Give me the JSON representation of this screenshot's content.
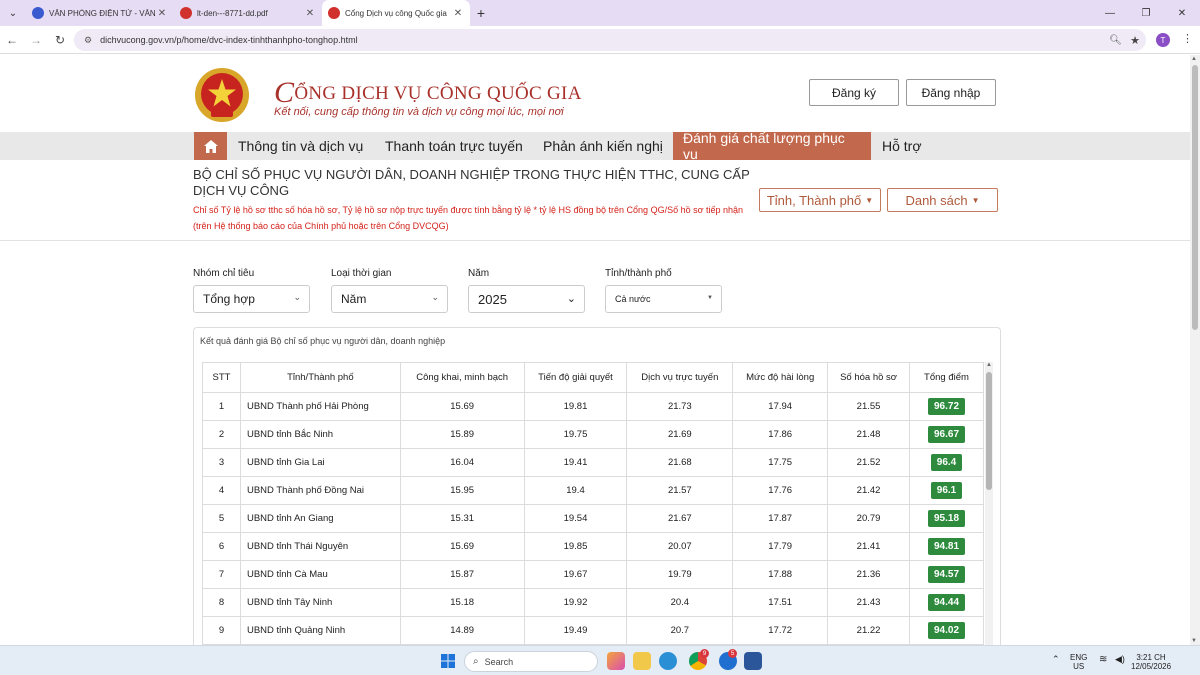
{
  "browser": {
    "tabs": [
      {
        "title": "VĂN PHÒNG ĐIỆN TỬ - VĂN PHÒNG",
        "favicon_color": "#3a5bd0",
        "active": false
      },
      {
        "title": "lt-den---8771-dd.pdf",
        "favicon_color": "#d0312d",
        "active": false
      },
      {
        "title": "Cổng Dịch vụ công Quốc gia",
        "favicon_color": "#d0312d",
        "active": true
      }
    ],
    "new_tab": "+",
    "url": "dichvucong.gov.vn/p/home/dvc-index-tinhthanhpho-tonghop.html",
    "profile_initial": "T"
  },
  "header": {
    "brand_title_initial": "C",
    "brand_title_rest": "ỔNG DỊCH VỤ CÔNG QUỐC GIA",
    "brand_subtitle": "Kết nối, cung cấp thông tin và dịch vụ công mọi lúc, mọi nơi",
    "register_label": "Đăng ký",
    "login_label": "Đăng nhập"
  },
  "nav": {
    "items": [
      {
        "label": "Thông tin và dịch vụ"
      },
      {
        "label": "Thanh toán trực tuyến"
      },
      {
        "label": "Phản ánh kiến nghị"
      },
      {
        "label": "Đánh giá chất lượng phục vụ"
      },
      {
        "label": "Hỗ trợ"
      }
    ]
  },
  "indicator": {
    "title": "BỘ CHỈ SỐ PHỤC VỤ NGƯỜI DÂN, DOANH NGHIỆP TRONG THỰC HIỆN TTHC, CUNG CẤP DỊCH VỤ CÔNG",
    "description": "Chỉ số Tỷ lệ hồ sơ tthc số hóa hồ sơ, Tỷ lệ hồ sơ nộp trực tuyến được tính bằng tỷ lệ * tỷ lệ HS đồng bộ trên Cổng QG/Số hồ sơ tiếp nhận (trên Hệ thống báo cáo của Chính phủ hoặc trên Cổng DVCQG)",
    "province_button": "Tỉnh, Thành phố",
    "list_button": "Danh sách"
  },
  "filters": [
    {
      "label": "Nhóm chỉ tiêu",
      "value": "Tổng hợp"
    },
    {
      "label": "Loại thời gian",
      "value": "Năm"
    },
    {
      "label": "Năm",
      "value": "2025"
    },
    {
      "label": "Tỉnh/thành phố",
      "value": "Cả nước"
    }
  ],
  "results": {
    "caption": "Kết quả đánh giá Bộ chỉ số phục vụ người dân, doanh nghiệp",
    "columns": [
      "STT",
      "Tỉnh/Thành phố",
      "Công khai, minh bạch",
      "Tiến độ giải quyết",
      "Dịch vụ trực tuyến",
      "Mức độ hài lòng",
      "Số hóa hồ sơ",
      "Tổng điểm"
    ],
    "rows": [
      [
        "1",
        "UBND Thành phố Hải Phòng",
        "15.69",
        "19.81",
        "21.73",
        "17.94",
        "21.55",
        "96.72"
      ],
      [
        "2",
        "UBND tỉnh Bắc Ninh",
        "15.89",
        "19.75",
        "21.69",
        "17.86",
        "21.48",
        "96.67"
      ],
      [
        "3",
        "UBND tỉnh Gia Lai",
        "16.04",
        "19.41",
        "21.68",
        "17.75",
        "21.52",
        "96.4"
      ],
      [
        "4",
        "UBND Thành phố Đồng Nai",
        "15.95",
        "19.4",
        "21.57",
        "17.76",
        "21.42",
        "96.1"
      ],
      [
        "5",
        "UBND tỉnh An Giang",
        "15.31",
        "19.54",
        "21.67",
        "17.87",
        "20.79",
        "95.18"
      ],
      [
        "6",
        "UBND tỉnh Thái Nguyên",
        "15.69",
        "19.85",
        "20.07",
        "17.79",
        "21.41",
        "94.81"
      ],
      [
        "7",
        "UBND tỉnh Cà Mau",
        "15.87",
        "19.67",
        "19.79",
        "17.88",
        "21.36",
        "94.57"
      ],
      [
        "8",
        "UBND tỉnh Tây Ninh",
        "15.18",
        "19.92",
        "20.4",
        "17.51",
        "21.43",
        "94.44"
      ],
      [
        "9",
        "UBND tỉnh Quảng Ninh",
        "14.89",
        "19.49",
        "20.7",
        "17.72",
        "21.22",
        "94.02"
      ]
    ]
  },
  "taskbar": {
    "search_placeholder": "Search",
    "lang_top": "ENG",
    "lang_bottom": "US",
    "time": "3:21 CH",
    "date": "12/05/2026",
    "badge_1": "9",
    "badge_2": "5"
  },
  "colors": {
    "brand_red": "#a8322b",
    "nav_accent": "#c2694d",
    "score_green": "#2e8b3e"
  }
}
